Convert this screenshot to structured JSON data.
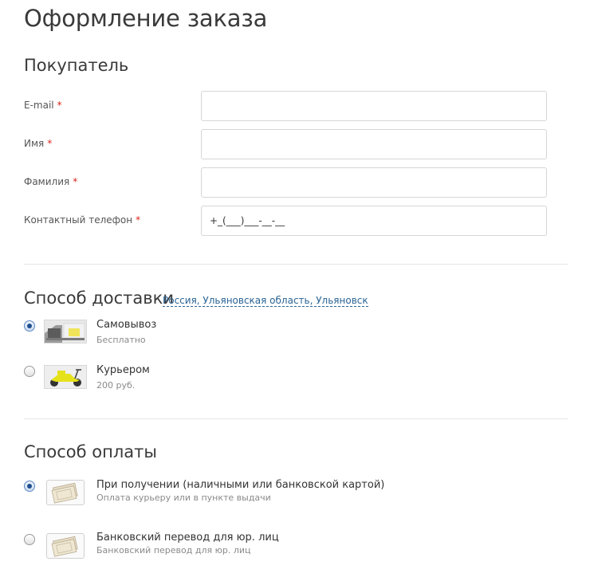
{
  "page": {
    "title": "Оформление заказа"
  },
  "buyer": {
    "section_title": "Покупатель",
    "required_mark": "*",
    "fields": [
      {
        "label": "E-mail",
        "value": ""
      },
      {
        "label": "Имя",
        "value": ""
      },
      {
        "label": "Фамилия",
        "value": ""
      },
      {
        "label": "Контактный телефон",
        "value": "+_(___)___-__-__"
      }
    ]
  },
  "delivery": {
    "section_title": "Способ доставки",
    "location": "Россия, Ульяновская область, Ульяновск",
    "options": [
      {
        "title": "Самовывоз",
        "subtitle": "Бесплатно",
        "selected": true,
        "icon": "store-pickup-icon"
      },
      {
        "title": "Курьером",
        "subtitle": "200 руб.",
        "selected": false,
        "icon": "courier-scooter-icon"
      }
    ]
  },
  "payment": {
    "section_title": "Способ оплаты",
    "options": [
      {
        "title": "При получении (наличными или банковской картой)",
        "subtitle": "Оплата курьеру или в пункте выдачи",
        "selected": true,
        "icon": "cash-icon"
      },
      {
        "title": "Банковский перевод для юр. лиц",
        "subtitle": "Банковский перевод для юр. лиц",
        "selected": false,
        "icon": "cash-icon"
      }
    ]
  },
  "colors": {
    "accent_link": "#2a6496",
    "required": "#d9261c",
    "radio_selected": "#1f4f8f"
  }
}
